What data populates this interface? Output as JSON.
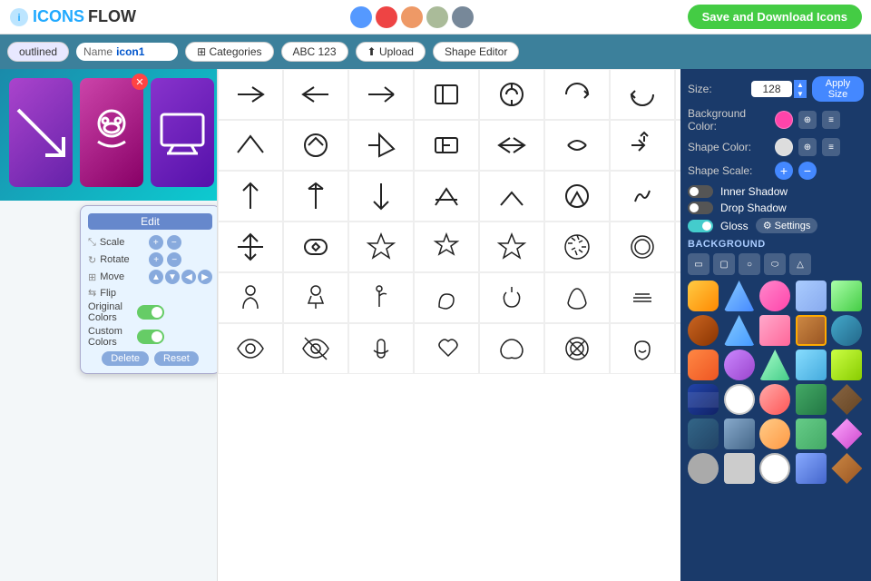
{
  "header": {
    "logo_text_icons": "ICONS",
    "logo_text_flow": "FLOW",
    "save_btn_label": "Save and Download Icons",
    "swatches": [
      "#5599ff",
      "#ee4444",
      "#ee9966",
      "#aabb99",
      "#778899"
    ]
  },
  "toolbar": {
    "outlined_label": "outlined",
    "name_label": "Name",
    "name_value": "icon1",
    "categories_label": "Categories",
    "abc_label": "ABC 123",
    "upload_label": "Upload",
    "shape_editor_label": "Shape Editor"
  },
  "edit_popup": {
    "title": "Edit",
    "scale_label": "Scale",
    "rotate_label": "Rotate",
    "move_label": "Move",
    "flip_label": "Flip",
    "original_colors_label": "Original Colors",
    "custom_colors_label": "Custom Colors",
    "delete_label": "Delete",
    "reset_label": "Reset"
  },
  "right_panel": {
    "size_label": "Size:",
    "size_value": "128",
    "apply_size_label": "Apply Size",
    "bg_color_label": "Background Color:",
    "shape_color_label": "Shape Color:",
    "shape_scale_label": "Shape Scale:",
    "inner_shadow_label": "Inner Shadow",
    "drop_shadow_label": "Drop Shadow",
    "gloss_label": "Gloss",
    "settings_label": "Settings",
    "background_label": "Background"
  },
  "colors": {
    "accent": "#44cc44",
    "primary": "#1a3a6a",
    "bg_color1": "#ff44aa",
    "bg_color2": "#aaaaaa",
    "shape_color1": "#dddddd"
  }
}
